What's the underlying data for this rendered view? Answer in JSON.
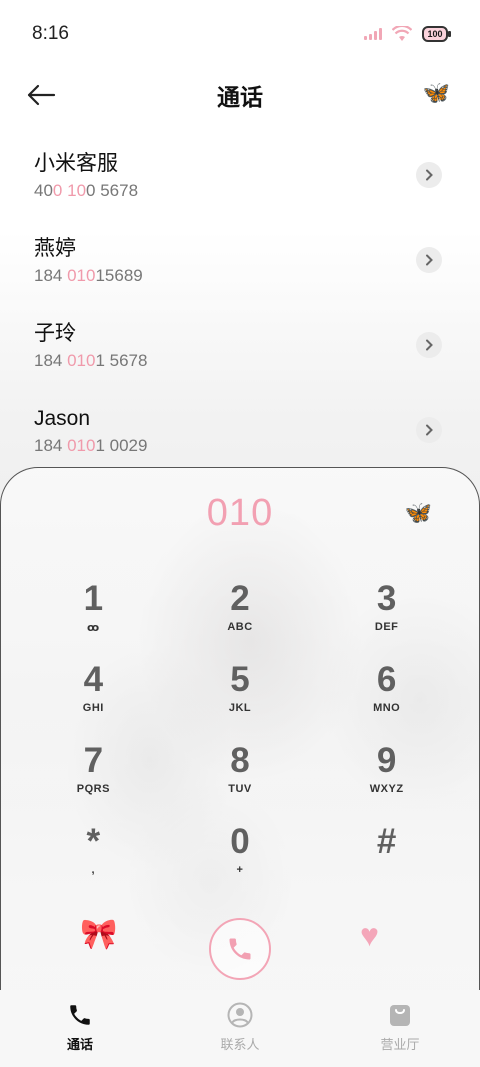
{
  "status": {
    "time": "8:16",
    "battery": "100"
  },
  "header": {
    "title": "通话"
  },
  "contacts": [
    {
      "name": "小米客服",
      "number_parts": [
        "40",
        "0",
        " ",
        "10",
        "0 5678"
      ]
    },
    {
      "name": "燕婷",
      "number_parts": [
        "184 ",
        "010",
        "15689",
        "",
        ""
      ]
    },
    {
      "name": "子玲",
      "number_parts": [
        "184 ",
        "010",
        "1 5678",
        "",
        ""
      ]
    },
    {
      "name": "Jason",
      "number_parts": [
        "184 ",
        "010",
        "1 0029",
        "",
        ""
      ]
    }
  ],
  "dialer": {
    "input": "010",
    "keys": [
      {
        "digit": "1",
        "letters": "ꝏ"
      },
      {
        "digit": "2",
        "letters": "ABC"
      },
      {
        "digit": "3",
        "letters": "DEF"
      },
      {
        "digit": "4",
        "letters": "GHI"
      },
      {
        "digit": "5",
        "letters": "JKL"
      },
      {
        "digit": "6",
        "letters": "MNO"
      },
      {
        "digit": "7",
        "letters": "PQRS"
      },
      {
        "digit": "8",
        "letters": "TUV"
      },
      {
        "digit": "9",
        "letters": "WXYZ"
      },
      {
        "digit": "*",
        "letters": ","
      },
      {
        "digit": "0",
        "letters": "+"
      },
      {
        "digit": "#",
        "letters": ""
      }
    ]
  },
  "nav": {
    "calls": "通话",
    "contacts": "联系人",
    "store": "营业厅"
  },
  "colors": {
    "accent_pink": "#f2a0b2",
    "highlight": "#f09aab"
  },
  "icons": {
    "top_decoration": "butterfly",
    "dial_decoration": "butterfly",
    "left_action": "bow",
    "right_action": "heart"
  }
}
